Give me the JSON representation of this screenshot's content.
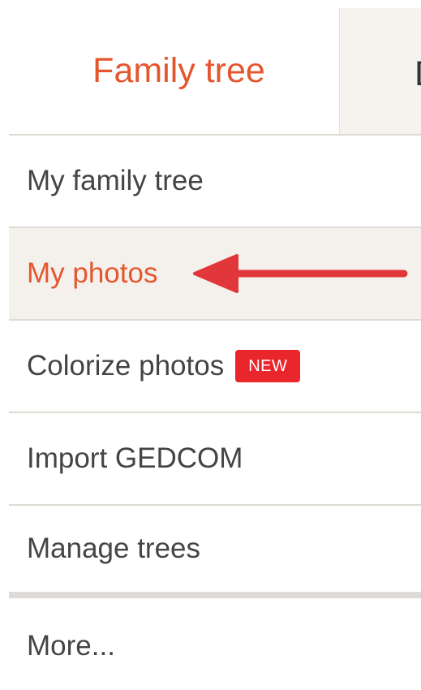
{
  "tabs": {
    "active_label": "Family tree",
    "next_label": "D"
  },
  "menu": {
    "items": [
      {
        "label": "My family tree",
        "active": false
      },
      {
        "label": "My photos",
        "active": true
      },
      {
        "label": "Colorize photos",
        "badge": "NEW",
        "active": false
      },
      {
        "label": "Import GEDCOM",
        "active": false
      },
      {
        "label": "Manage trees",
        "active": false
      },
      {
        "label": "More...",
        "active": false
      }
    ]
  },
  "colors": {
    "accent": "#e4572e",
    "badge": "#e8262b",
    "arrow": "#e2373a",
    "active_row_bg": "#f4f1ed"
  },
  "annotation": {
    "icon": "left-arrow-icon",
    "points_to": "My photos"
  }
}
